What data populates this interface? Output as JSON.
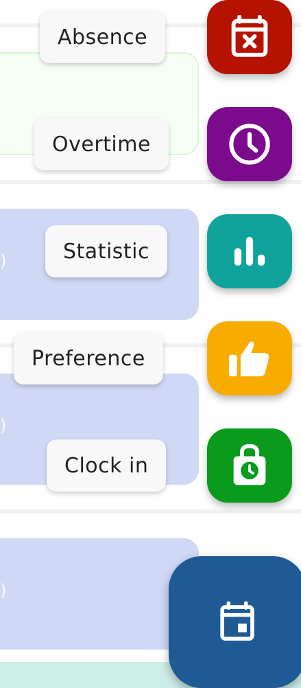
{
  "speed_dial": {
    "actions": [
      {
        "label": "Absence",
        "icon": "calendar-x-icon",
        "color": "#b51300"
      },
      {
        "label": "Overtime",
        "icon": "clock-icon",
        "color": "#7b0a8c"
      },
      {
        "label": "Statistic",
        "icon": "bar-chart-icon",
        "color": "#0fa39c"
      },
      {
        "label": "Preference",
        "icon": "thumbs-up-icon",
        "color": "#f9ac00"
      },
      {
        "label": "Clock in",
        "icon": "time-clock-icon",
        "color": "#0a9a1c"
      }
    ],
    "main_button": {
      "icon": "calendar-event-icon",
      "color": "#1f5a95"
    }
  },
  "background": {
    "card_edge_marks": [
      ")",
      ")",
      ")"
    ]
  }
}
